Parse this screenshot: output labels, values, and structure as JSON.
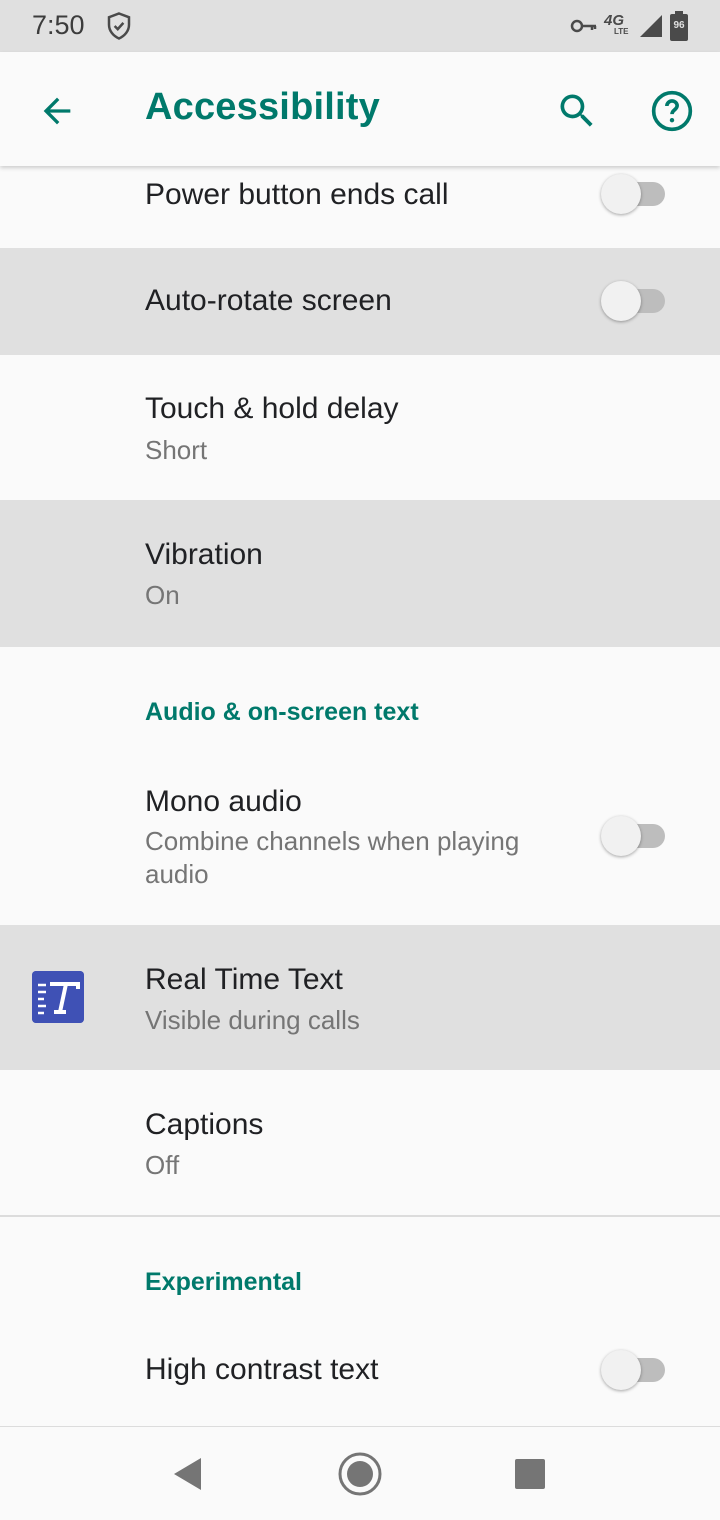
{
  "status_bar": {
    "time": "7:50",
    "network": "4G",
    "network_sub": "LTE",
    "battery": "96"
  },
  "app_bar": {
    "title": "Accessibility",
    "back_icon": "arrow-back-icon",
    "search_icon": "search-icon",
    "help_icon": "help-icon"
  },
  "settings": {
    "power_button": {
      "title": "Power button ends call",
      "enabled": false
    },
    "auto_rotate": {
      "title": "Auto-rotate screen",
      "enabled": false
    },
    "touch_hold": {
      "title": "Touch & hold delay",
      "summary": "Short"
    },
    "vibration": {
      "title": "Vibration",
      "summary": "On"
    },
    "audio_section": {
      "title": "Audio & on-screen text"
    },
    "mono_audio": {
      "title": "Mono audio",
      "summary": "Combine channels when playing audio",
      "enabled": false
    },
    "real_time_text": {
      "title": "Real Time Text",
      "summary": "Visible during calls",
      "icon": "real-time-text-icon"
    },
    "captions": {
      "title": "Captions",
      "summary": "Off"
    },
    "experimental_section": {
      "title": "Experimental"
    },
    "high_contrast": {
      "title": "High contrast text",
      "enabled": false
    }
  },
  "nav_bar": {
    "back": "nav-back-icon",
    "home": "nav-home-icon",
    "recents": "nav-recents-icon"
  },
  "colors": {
    "accent": "#00796b",
    "highlight_row": "#e0e0e0",
    "rtt_icon_bg": "#3f51b5"
  }
}
